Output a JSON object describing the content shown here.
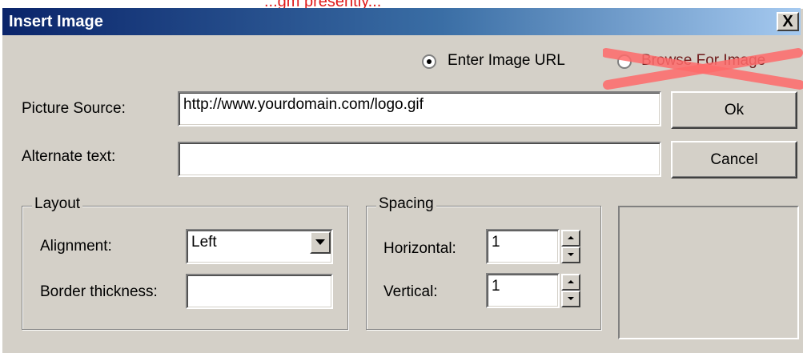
{
  "annotation": {
    "text": "...gm presently...",
    "color": "#e01818"
  },
  "window": {
    "title": "Insert Image",
    "close_label": "X",
    "titlebar_color": "#0a246a",
    "face_color": "#d4d0c8"
  },
  "source_mode": {
    "options": [
      {
        "label": "Enter Image URL",
        "checked": true
      },
      {
        "label": "Browse For Image",
        "checked": false,
        "crossed_out": true
      }
    ]
  },
  "picture_source": {
    "label": "Picture Source:",
    "value": "http://www.yourdomain.com/logo.gif"
  },
  "alternate_text": {
    "label": "Alternate text:",
    "value": ""
  },
  "buttons": {
    "ok": "Ok",
    "cancel": "Cancel"
  },
  "layout": {
    "legend": "Layout",
    "alignment_label": "Alignment:",
    "alignment_value": "Left",
    "border_label": "Border thickness:",
    "border_value": ""
  },
  "spacing": {
    "legend": "Spacing",
    "horizontal_label": "Horizontal:",
    "horizontal_value": "1",
    "vertical_label": "Vertical:",
    "vertical_value": "1"
  },
  "icons": {
    "close": "close-icon",
    "dropdown": "chevron-down-icon",
    "spin_up": "spin-up-icon",
    "spin_down": "spin-down-icon"
  }
}
